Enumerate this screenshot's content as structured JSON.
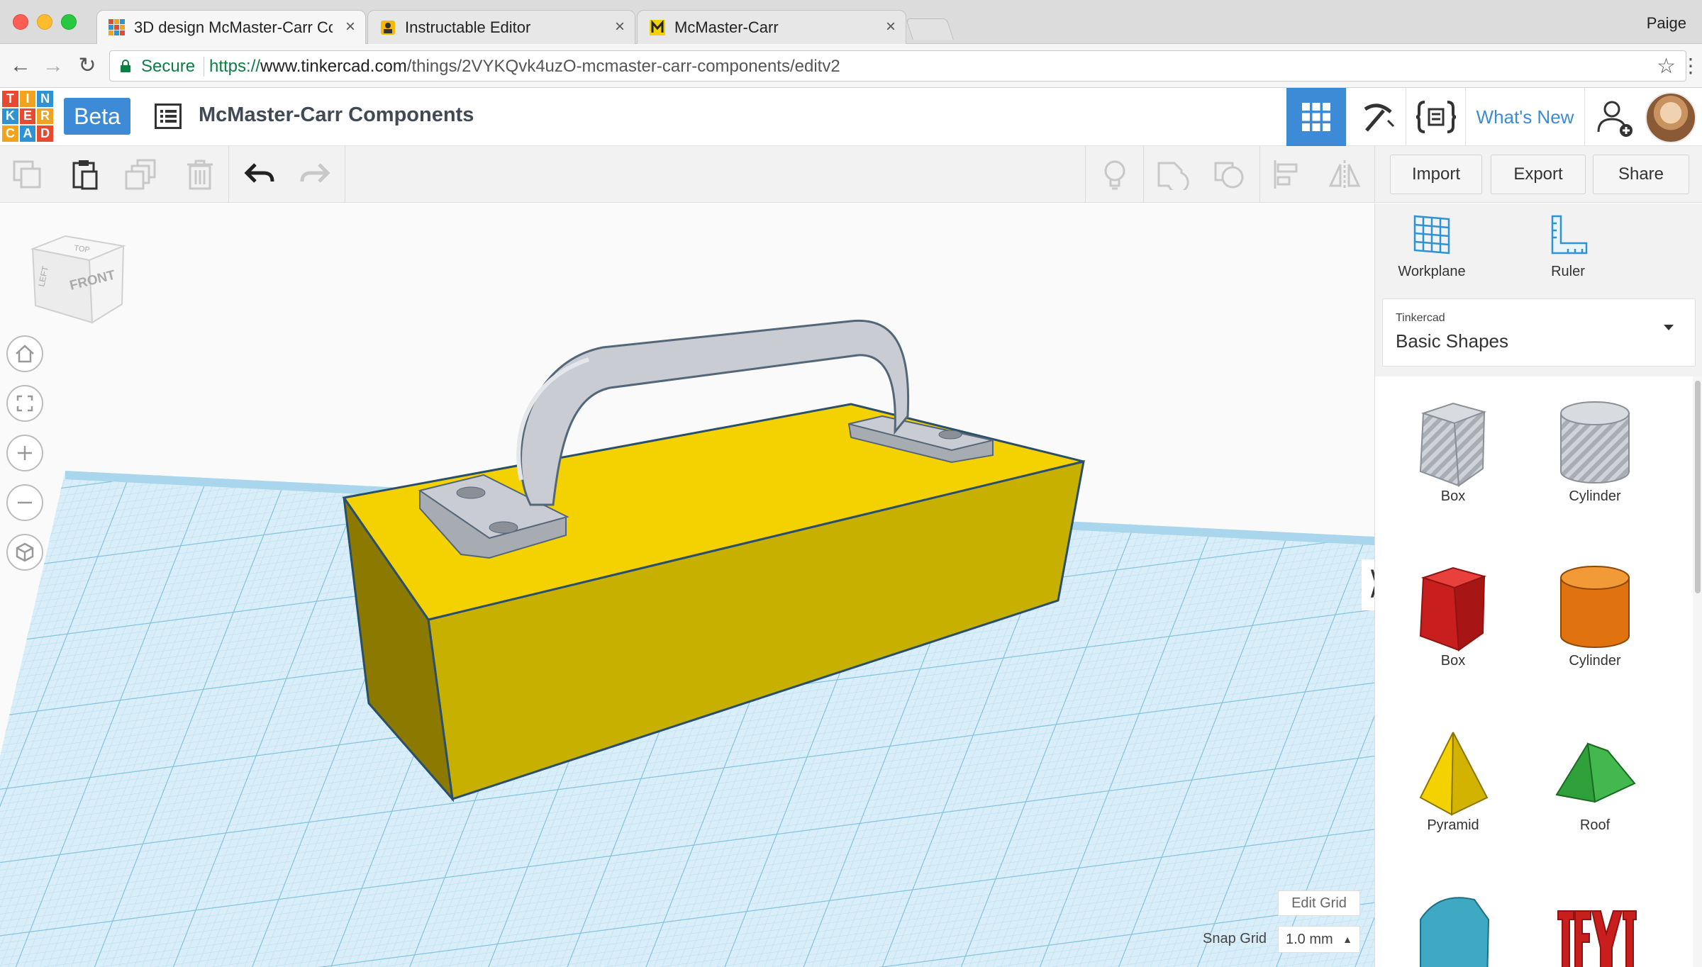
{
  "browser": {
    "tabs": [
      {
        "title": "3D design McMaster-Carr Con",
        "favicon": "tinkercad-favicon",
        "active": true
      },
      {
        "title": "Instructable Editor",
        "favicon": "instructables-favicon",
        "active": false
      },
      {
        "title": "McMaster-Carr",
        "favicon": "mcmaster-favicon",
        "active": false
      }
    ],
    "tab_close": "×",
    "user_name": "Paige",
    "secure_label": "Secure",
    "url_scheme": "https://",
    "url_host": "www.tinkercad.com",
    "url_path": "/things/2VYKQvk4uzO-mcmaster-carr-components/editv2"
  },
  "app": {
    "logo_letters": [
      "T",
      "I",
      "N",
      "K",
      "E",
      "R",
      "C",
      "A",
      "D"
    ],
    "logo_colors": [
      "#e84a2f",
      "#f3a31b",
      "#2d93d4",
      "#2d93d4",
      "#e84a2f",
      "#f3a31b",
      "#f3a31b",
      "#2d93d4",
      "#e84a2f"
    ],
    "beta_label": "Beta",
    "design_title": "McMaster-Carr Components",
    "whats_new": "What's New",
    "accent": "#3d8bd6"
  },
  "toolbar": {
    "import": "Import",
    "export": "Export",
    "share": "Share"
  },
  "viewport": {
    "viewcube_top": "TOP",
    "viewcube_front": "FRONT",
    "viewcube_left": "LEFT",
    "edit_grid": "Edit Grid",
    "snap_grid_label": "Snap Grid",
    "snap_grid_value": "1.0 mm",
    "box_color": "#f4d100",
    "handle_color": "#c9ccd2"
  },
  "panel": {
    "workplane": "Workplane",
    "ruler": "Ruler",
    "library_source": "Tinkercad",
    "library_name": "Basic Shapes",
    "shapes": [
      {
        "label": "Box",
        "icon": "box-hole-icon"
      },
      {
        "label": "Cylinder",
        "icon": "cylinder-hole-icon"
      },
      {
        "label": "Box",
        "icon": "box-red-icon"
      },
      {
        "label": "Cylinder",
        "icon": "cylinder-orange-icon"
      },
      {
        "label": "Pyramid",
        "icon": "pyramid-icon"
      },
      {
        "label": "Roof",
        "icon": "roof-icon"
      }
    ]
  }
}
